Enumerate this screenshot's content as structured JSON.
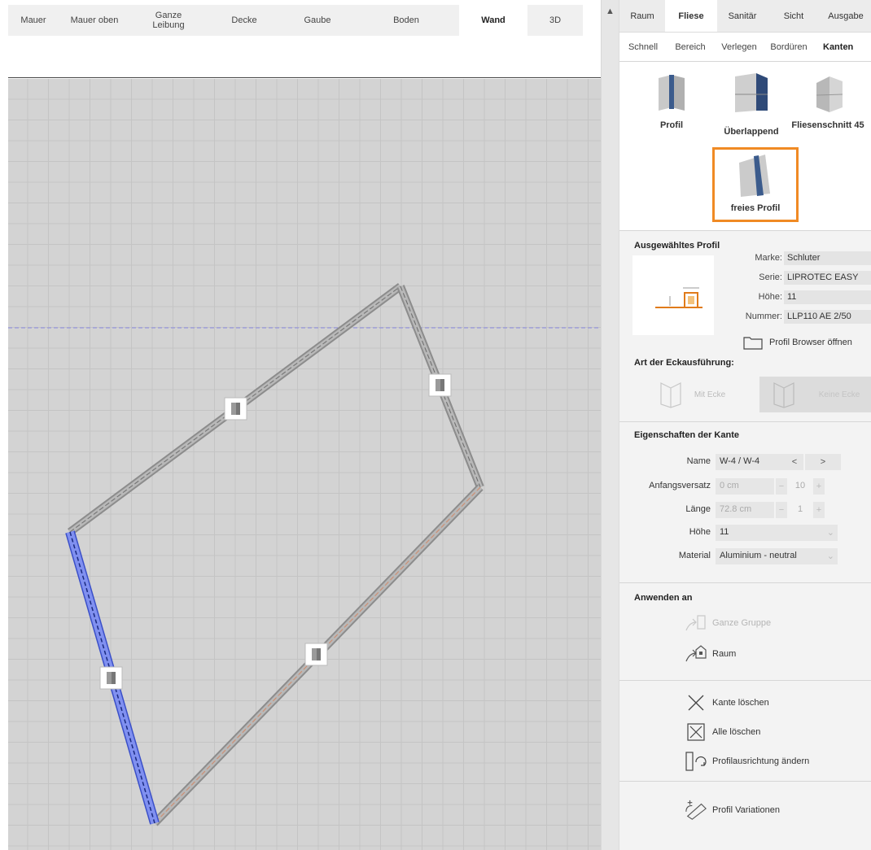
{
  "view_tabs": [
    {
      "label": "Mauer",
      "active": false
    },
    {
      "label": "Mauer oben",
      "active": false
    },
    {
      "label": "Ganze Leibung",
      "active": false
    },
    {
      "label": "Decke",
      "active": false
    },
    {
      "label": "Gaube",
      "active": false
    },
    {
      "label": "Boden",
      "active": false
    },
    {
      "label": "Wand",
      "active": true
    },
    {
      "label": "3D",
      "active": false
    }
  ],
  "main_tabs": [
    {
      "label": "Raum",
      "active": false
    },
    {
      "label": "Fliese",
      "active": true
    },
    {
      "label": "Sanitär",
      "active": false
    },
    {
      "label": "Sicht",
      "active": false
    },
    {
      "label": "Ausgabe",
      "active": false
    }
  ],
  "sub_tabs": [
    {
      "label": "Schnell",
      "active": false
    },
    {
      "label": "Bereich",
      "active": false
    },
    {
      "label": "Verlegen",
      "active": false
    },
    {
      "label": "Bordüren",
      "active": false
    },
    {
      "label": "Kanten",
      "active": true
    }
  ],
  "edge_types": [
    {
      "label": "Profil",
      "icon": "profile-edge-icon"
    },
    {
      "label": "Überlappend",
      "icon": "overlap-edge-icon"
    },
    {
      "label": "Fliesenschnitt 45",
      "icon": "miter-cut-icon"
    },
    {
      "label": "freies Profil",
      "icon": "free-profile-icon",
      "selected": true
    }
  ],
  "selected_profile": {
    "title": "Ausgewähltes Profil",
    "marke_label": "Marke:",
    "marke": "Schluter",
    "serie_label": "Serie:",
    "serie": "LIPROTEC EASY",
    "hoehe_label": "Höhe:",
    "hoehe": "11",
    "nummer_label": "Nummer:",
    "nummer": "LLP110 AE 2/50",
    "browser_label": "Profil Browser öffnen"
  },
  "corner": {
    "title": "Art der Eckausführung:",
    "mit_ecke": "Mit Ecke",
    "keine_ecke": "Keine Ecke"
  },
  "edge_props": {
    "title": "Eigenschaften der Kante",
    "name_label": "Name",
    "name_value": "W-4 / W-4",
    "prev_symbol": "<",
    "next_symbol": ">",
    "offset_label": "Anfangsversatz",
    "offset_value": "0 cm",
    "offset_step": "10",
    "length_label": "Länge",
    "length_value": "72.8 cm",
    "length_step": "1",
    "height_label": "Höhe",
    "height_value": "11",
    "material_label": "Material",
    "material_value": "Aluminium - neutral",
    "minus": "−",
    "plus": "+"
  },
  "apply": {
    "title": "Anwenden an",
    "whole_group": "Ganze Gruppe",
    "room": "Raum"
  },
  "actions": {
    "delete_edge": "Kante löschen",
    "delete_all": "Alle löschen",
    "change_orientation": "Profilausrichtung ändern",
    "variations": "Profil Variationen"
  },
  "colors": {
    "accent_orange": "#f08a24",
    "selected_edge": "#5a6ee0",
    "profile_blue": "#3b5b8c"
  }
}
